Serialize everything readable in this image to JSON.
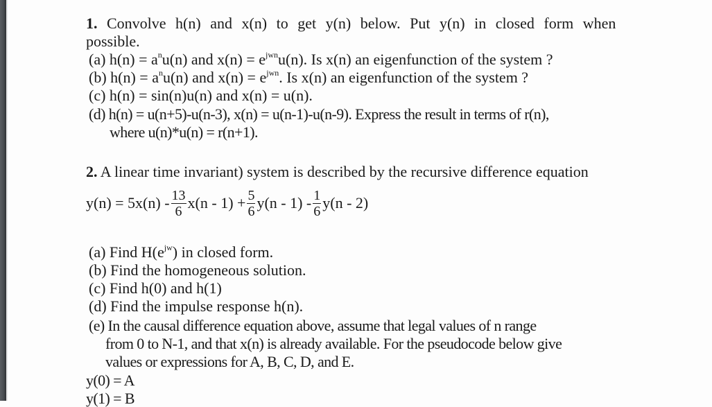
{
  "q1": {
    "number": "1.",
    "intro_line1": "Convolve h(n) and x(n) to get y(n) below. Put y(n) in closed form when",
    "intro_line2": "possible.",
    "a": {
      "prefix": "(a) h(n) = a",
      "sup1": "n",
      "mid": "u(n) and x(n) = e",
      "sup2": "jwn",
      "suffix": "u(n). Is x(n) an eigenfunction of the system ?"
    },
    "b": {
      "prefix": "(b) h(n) = a",
      "sup1": "n",
      "mid": "u(n) and x(n) = e",
      "sup2": "jwn",
      "suffix": ". Is x(n) an eigenfunction of the system ?"
    },
    "c": "(c) h(n) = sin(n)u(n) and x(n) = u(n).",
    "d_line1": "(d) h(n) = u(n+5)-u(n-3),  x(n) = u(n-1)-u(n-9). Express the result in terms of r(n),",
    "d_line2": "where u(n)*u(n) = r(n+1)."
  },
  "q2": {
    "number": "2.",
    "intro": "A linear time invariant) system is described by the recursive difference equation",
    "equation": {
      "lhs": "y(n) = 5x(n) -",
      "f1_num": "13",
      "f1_den": "6",
      "t1": "x(n - 1) +",
      "f2_num": "5",
      "f2_den": "6",
      "t2": "y(n - 1) -",
      "f3_num": "1",
      "f3_den": "6",
      "t3": "y(n - 2)"
    },
    "a": {
      "prefix": "(a) Find H(e",
      "sup": "jw",
      "suffix": ") in closed form."
    },
    "b": "(b) Find the homogeneous solution.",
    "c": "(c) Find h(0) and h(1)",
    "d": "(d) Find the impulse response h(n).",
    "e_line1": "(e) In the causal difference equation above, assume that legal values of n range",
    "e_line2": "from 0 to N-1, and that x(n) is already available. For the pseudocode below give",
    "e_line3": "values or expressions for A, B, C, D, and E.",
    "code_line1": "y(0) = A",
    "code_line2": "y(1) = B"
  }
}
